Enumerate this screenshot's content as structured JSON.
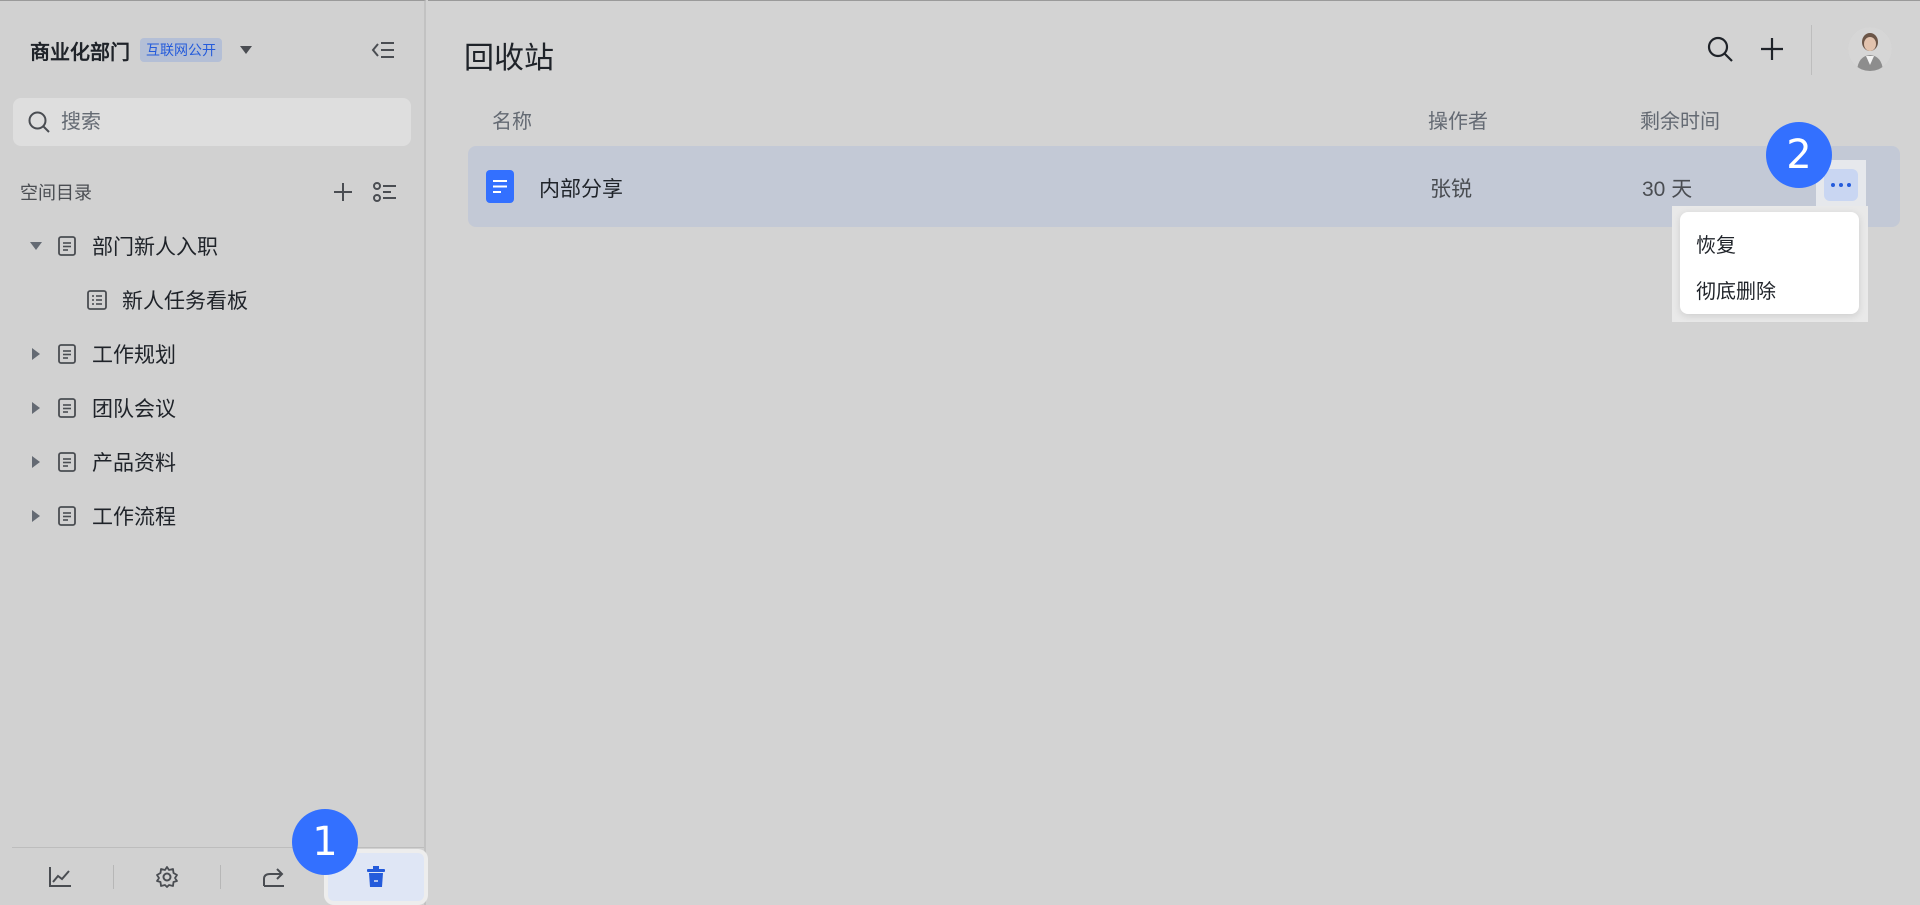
{
  "sidebar": {
    "space_name": "商业化部门",
    "space_badge": "互联网公开",
    "search_placeholder": "搜索",
    "dir_title": "空间目录",
    "tree": [
      {
        "label": "部门新人入职",
        "expanded": true
      },
      {
        "label": "新人任务看板",
        "child": true
      },
      {
        "label": "工作规划",
        "expanded": false
      },
      {
        "label": "团队会议",
        "expanded": false
      },
      {
        "label": "产品资料",
        "expanded": false
      },
      {
        "label": "工作流程",
        "expanded": false
      }
    ],
    "bottom_icons": [
      "chart-icon",
      "settings-icon",
      "share-icon",
      "trash-icon"
    ]
  },
  "main": {
    "title": "回收站",
    "columns": {
      "name": "名称",
      "operator": "操作者",
      "remaining": "剩余时间"
    },
    "rows": [
      {
        "name": "内部分享",
        "operator": "张锐",
        "remaining": "30 天"
      }
    ],
    "menu": {
      "restore": "恢复",
      "delete": "彻底删除"
    }
  },
  "markers": {
    "one": "1",
    "two": "2"
  },
  "colors": {
    "accent": "#3370ff",
    "badge_text": "#245bdb",
    "doc_icon": "#3370ff"
  }
}
